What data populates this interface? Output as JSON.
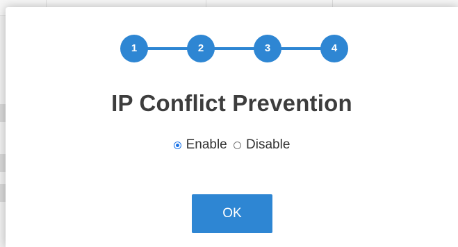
{
  "dialog": {
    "steps": [
      "1",
      "2",
      "3",
      "4"
    ],
    "current_step": 4,
    "title": "IP Conflict Prevention",
    "options": [
      {
        "label": "Enable",
        "selected": true
      },
      {
        "label": "Disable",
        "selected": false
      }
    ],
    "ok_label": "OK"
  },
  "colors": {
    "accent": "#2e86d3",
    "title_text": "#3d3d3d",
    "body_text": "#333333"
  }
}
